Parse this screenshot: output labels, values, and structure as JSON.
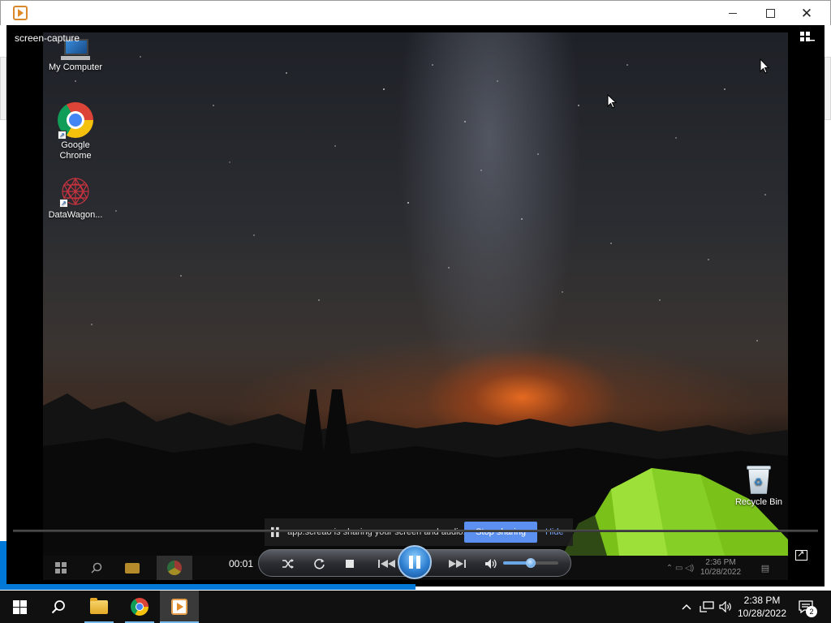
{
  "window": {
    "app_icon": "media-player-icon",
    "controls": [
      "minimize-icon",
      "maximize-icon",
      "close-icon"
    ]
  },
  "player": {
    "capture_label": "screen-capture",
    "layout_icon": "layout-toggle-icon",
    "timecode": "00:01",
    "seek_progress": 0.0,
    "volume_level": 0.5,
    "state": "playing",
    "accent_color": "#3b8ee0",
    "controls": [
      "shuffle-icon",
      "repeat-icon",
      "stop-icon",
      "previous-icon",
      "pause-icon",
      "next-icon",
      "volume-icon"
    ]
  },
  "captured_desktop": {
    "icons": [
      {
        "label": "My Computer",
        "icon": "computer-icon"
      },
      {
        "label": "Google Chrome",
        "icon": "chrome-icon"
      },
      {
        "label": "DataWagon...",
        "icon": "datawagon-icon"
      },
      {
        "label": "Recycle Bin",
        "icon": "recycle-bin-icon"
      }
    ],
    "share_bar": {
      "text": "app.screao is sharing your screen and audio.",
      "stop_button": "Stop sharing",
      "hide_link": "Hide"
    },
    "taskbar_clock": {
      "time": "2:36 PM",
      "date": "10/28/2022"
    }
  },
  "load_progress": 0.5,
  "taskbar": {
    "items": [
      "start-icon",
      "search-icon",
      "file-explorer-icon",
      "chrome-icon",
      "media-player-icon"
    ],
    "tray": [
      "chevron-up-icon",
      "network-icon",
      "volume-icon"
    ],
    "clock": {
      "time": "2:38 PM",
      "date": "10/28/2022"
    },
    "notification_count": "2",
    "accent_color": "#0078d7"
  }
}
